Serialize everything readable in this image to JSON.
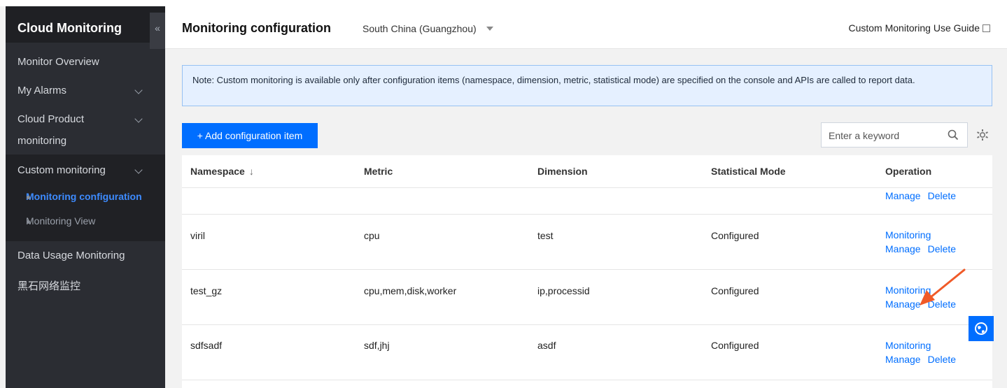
{
  "sidebar": {
    "title": "Cloud Monitoring",
    "collapse_glyph": "«",
    "items": [
      {
        "label": "Monitor Overview"
      },
      {
        "label": "My Alarms"
      },
      {
        "label_line1": "Cloud Product",
        "label_line2": "monitoring"
      },
      {
        "label": "Custom monitoring"
      },
      {
        "label": "Data Usage Monitoring"
      },
      {
        "label": "黑石网络监控"
      }
    ],
    "sub_items": [
      {
        "label": "Monitoring configuration",
        "active": true
      },
      {
        "label": "Monitoring View",
        "active": false
      }
    ]
  },
  "header": {
    "title": "Monitoring configuration",
    "region": "South China (Guangzhou)",
    "guide_link": "Custom Monitoring Use Guide"
  },
  "notice": {
    "text": "Note: Custom monitoring is available only after configuration items (namespace, dimension, metric, statistical mode) are specified on the console and APIs are called to report data."
  },
  "toolbar": {
    "add_label": "+ Add configuration item",
    "search_placeholder": "Enter a keyword"
  },
  "table": {
    "columns": [
      "Namespace",
      "Metric",
      "Dimension",
      "Statistical Mode",
      "Operation"
    ],
    "sort_glyph": "↓",
    "op_labels": {
      "monitoring": "Monitoring",
      "manage": "Manage",
      "delete": "Delete"
    },
    "rows": [
      {
        "namespace": "",
        "metric": "",
        "dimension": "",
        "mode": ""
      },
      {
        "namespace": "viril",
        "metric": "cpu",
        "dimension": "test",
        "mode": "Configured"
      },
      {
        "namespace": "test_gz",
        "metric": "cpu,mem,disk,worker",
        "dimension": "ip,processid",
        "mode": "Configured"
      },
      {
        "namespace": "sdfsadf",
        "metric": "sdf,jhj",
        "dimension": "asdf",
        "mode": "Configured"
      }
    ]
  },
  "colors": {
    "accent": "#006eff",
    "sidebar_bg": "#2b2d33",
    "arrow": "#f05a28"
  }
}
